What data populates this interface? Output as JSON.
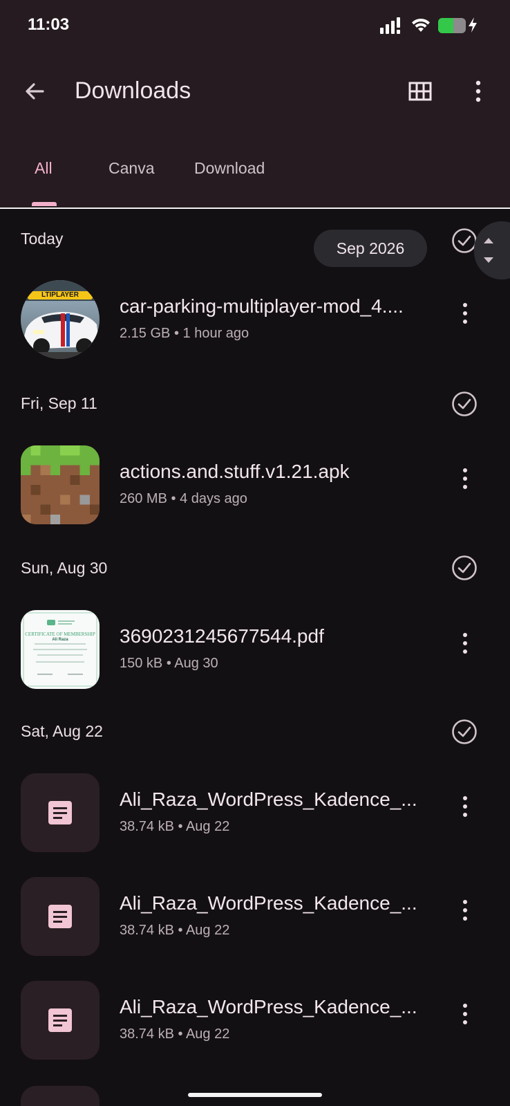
{
  "status_bar": {
    "time": "11:03",
    "battery_level": 0.55,
    "battery_color": "#34c84a"
  },
  "app_bar": {
    "title": "Downloads",
    "back_icon": "arrow-back-icon",
    "view_icon": "grid-view-icon",
    "more_icon": "more-vert-icon"
  },
  "tabs": [
    {
      "label": "All",
      "active": true
    },
    {
      "label": "Canva",
      "active": false
    },
    {
      "label": "Download",
      "active": false
    }
  ],
  "accent_color": "#f3b0cb",
  "scroll_chip": "Sep 2026",
  "sections": [
    {
      "label": "Today",
      "files": [
        {
          "name": "car-parking-multiplayer-mod_4....",
          "size": "2.15 GB",
          "time": "1 hour ago",
          "thumb_icon": "car-game-thumbnail",
          "thumb_text": "LTIPLAYER"
        }
      ]
    },
    {
      "label": "Fri, Sep 11",
      "files": [
        {
          "name": "actions.and.stuff.v1.21.apk",
          "size": "260 MB",
          "time": "4 days ago",
          "thumb_icon": "minecraft-grass-block-icon"
        }
      ]
    },
    {
      "label": "Sun, Aug 30",
      "files": [
        {
          "name": "3690231245677544.pdf",
          "size": "150 kB",
          "time": "Aug 30",
          "thumb_icon": "certificate-thumbnail",
          "thumb_title": "CERTIFICATE OF MEMBERSHIP",
          "thumb_name": "Ali Raza"
        }
      ]
    },
    {
      "label": "Sat, Aug 22",
      "files": [
        {
          "name": "Ali_Raza_WordPress_Kadence_...",
          "size": "38.74 kB",
          "time": "Aug 22",
          "thumb_icon": "document-icon"
        },
        {
          "name": "Ali_Raza_WordPress_Kadence_...",
          "size": "38.74 kB",
          "time": "Aug 22",
          "thumb_icon": "document-icon"
        },
        {
          "name": "Ali_Raza_WordPress_Kadence_...",
          "size": "38.74 kB",
          "time": "Aug 22",
          "thumb_icon": "document-icon"
        }
      ]
    }
  ]
}
